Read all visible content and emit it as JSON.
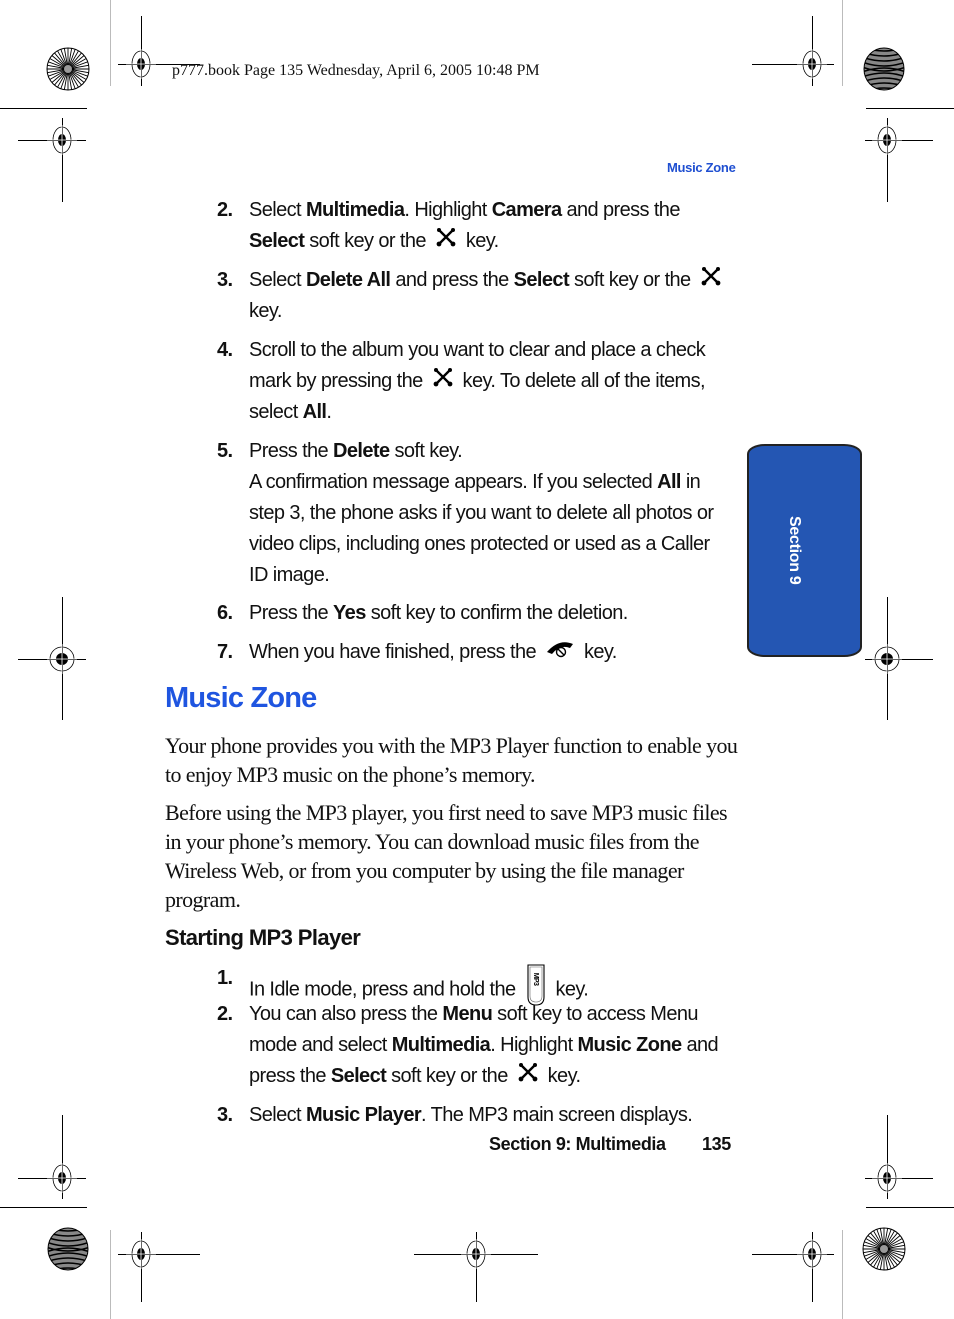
{
  "print_header": "p777.book  Page 135  Wednesday, April 6, 2005  10:48 PM",
  "running_head": "Music Zone",
  "section_tab": "Section 9",
  "steps_top": [
    {
      "num": "2.",
      "parts": [
        {
          "t": "Select "
        },
        {
          "b": "Multimedia"
        },
        {
          "t": ". Highlight "
        },
        {
          "b": "Camera"
        },
        {
          "t": " and press the "
        },
        {
          "br": true
        },
        {
          "b": "Select"
        },
        {
          "t": " soft key or the "
        },
        {
          "icon": "nav-key"
        },
        {
          "t": " key."
        }
      ]
    },
    {
      "num": "3.",
      "parts": [
        {
          "t": "Select "
        },
        {
          "b": "Delete All"
        },
        {
          "t": " and press the "
        },
        {
          "b": "Select"
        },
        {
          "t": " soft key or the "
        },
        {
          "icon": "nav-key"
        },
        {
          "br": true
        },
        {
          "t": "key."
        }
      ]
    },
    {
      "num": "4.",
      "parts": [
        {
          "t": "Scroll to the album you want to clear and place a check"
        },
        {
          "br": true
        },
        {
          "t": "mark by pressing the "
        },
        {
          "icon": "nav-key"
        },
        {
          "t": " key. To delete all of the items,"
        },
        {
          "br": true
        },
        {
          "t": "select "
        },
        {
          "b": "All"
        },
        {
          "t": "."
        }
      ]
    },
    {
      "num": "5.",
      "parts": [
        {
          "t": "Press the "
        },
        {
          "b": "Delete"
        },
        {
          "t": " soft key."
        },
        {
          "br": true
        },
        {
          "t": "A confirmation message appears. If you selected "
        },
        {
          "b": "All"
        },
        {
          "t": " in"
        },
        {
          "br": true
        },
        {
          "t": "step 3, the phone asks if you want to delete all photos or"
        },
        {
          "br": true
        },
        {
          "t": "video clips, including ones protected or used as a Caller"
        },
        {
          "br": true
        },
        {
          "t": "ID image."
        }
      ]
    },
    {
      "num": "6.",
      "parts": [
        {
          "t": "Press the "
        },
        {
          "b": "Yes"
        },
        {
          "t": " soft key to confirm the deletion."
        }
      ]
    },
    {
      "num": "7.",
      "parts": [
        {
          "t": "When you have finished, press the "
        },
        {
          "icon": "end-key"
        },
        {
          "t": " key."
        }
      ]
    }
  ],
  "section_title": "Music Zone",
  "paragraphs": [
    "Your phone provides you with the MP3 Player function to enable you to enjoy MP3 music on the phone’s memory.",
    "Before using the MP3 player, you first need to save MP3 music files in your phone’s memory. You can download music files from the Wireless Web, or from you computer by using the file manager program."
  ],
  "subheading": "Starting MP3 Player",
  "steps_bottom": [
    {
      "num": "1.",
      "parts": [
        {
          "t": "In Idle mode, press and hold the "
        },
        {
          "icon": "mp3-key"
        },
        {
          "t": " key."
        }
      ]
    },
    {
      "num": "2.",
      "parts": [
        {
          "t": "You can also press the "
        },
        {
          "b": "Menu"
        },
        {
          "t": " soft key to access Menu"
        },
        {
          "br": true
        },
        {
          "t": "mode and select "
        },
        {
          "b": "Multimedia"
        },
        {
          "t": ". Highlight "
        },
        {
          "b": "Music Zone"
        },
        {
          "t": " and"
        },
        {
          "br": true
        },
        {
          "t": "press the "
        },
        {
          "b": "Select"
        },
        {
          "t": " soft key or the "
        },
        {
          "icon": "nav-key"
        },
        {
          "t": " key."
        }
      ]
    },
    {
      "num": "3.",
      "parts": [
        {
          "t": "Select "
        },
        {
          "b": "Music Player"
        },
        {
          "t": ". The MP3 main screen displays."
        }
      ]
    }
  ],
  "footer": {
    "section": "Section 9: Multimedia",
    "page": "135"
  },
  "colors": {
    "accent": "#1f55e0",
    "tab": "#2456b3"
  }
}
